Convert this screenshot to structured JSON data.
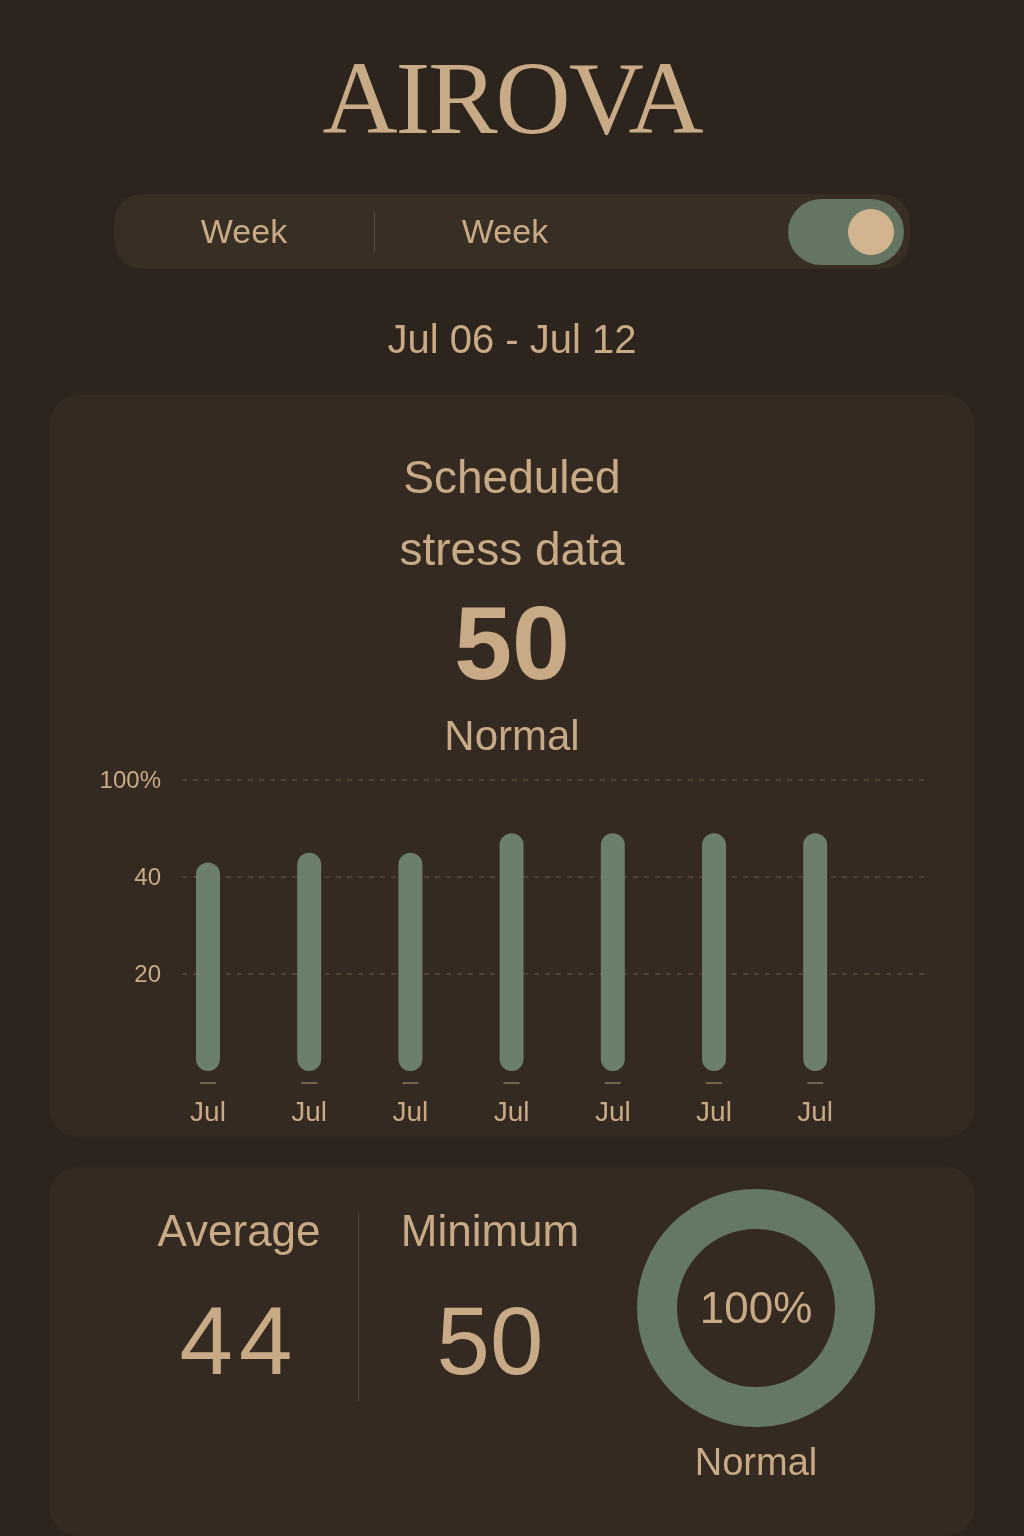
{
  "app": {
    "title": "AIROVA"
  },
  "period_switch": {
    "segments": [
      {
        "label": "Week"
      },
      {
        "label": "Week"
      }
    ],
    "toggle": {
      "on": true
    }
  },
  "date_range": "Jul 06 - Jul 12",
  "stress_card": {
    "title": "Scheduled stress data",
    "score": "50",
    "status": "Normal",
    "chart_data": {
      "type": "bar",
      "categories": [
        "Jul",
        "Jul",
        "Jul",
        "Jul",
        "Jul",
        "Jul",
        "Jul"
      ],
      "series": [
        {
          "color": "#6b7f6c",
          "values": [
            43,
            45,
            45,
            49,
            49,
            49,
            49
          ]
        }
      ],
      "ylim": [
        0,
        60
      ],
      "yticks": [
        20,
        40
      ]
    },
    "axis_top_label": "100%"
  },
  "summary_card": {
    "stats": [
      {
        "label": "Average",
        "value": "44"
      },
      {
        "label": "Minimum",
        "value": "50"
      }
    ],
    "ring": {
      "reading": "100%",
      "status": "Normal"
    }
  }
}
